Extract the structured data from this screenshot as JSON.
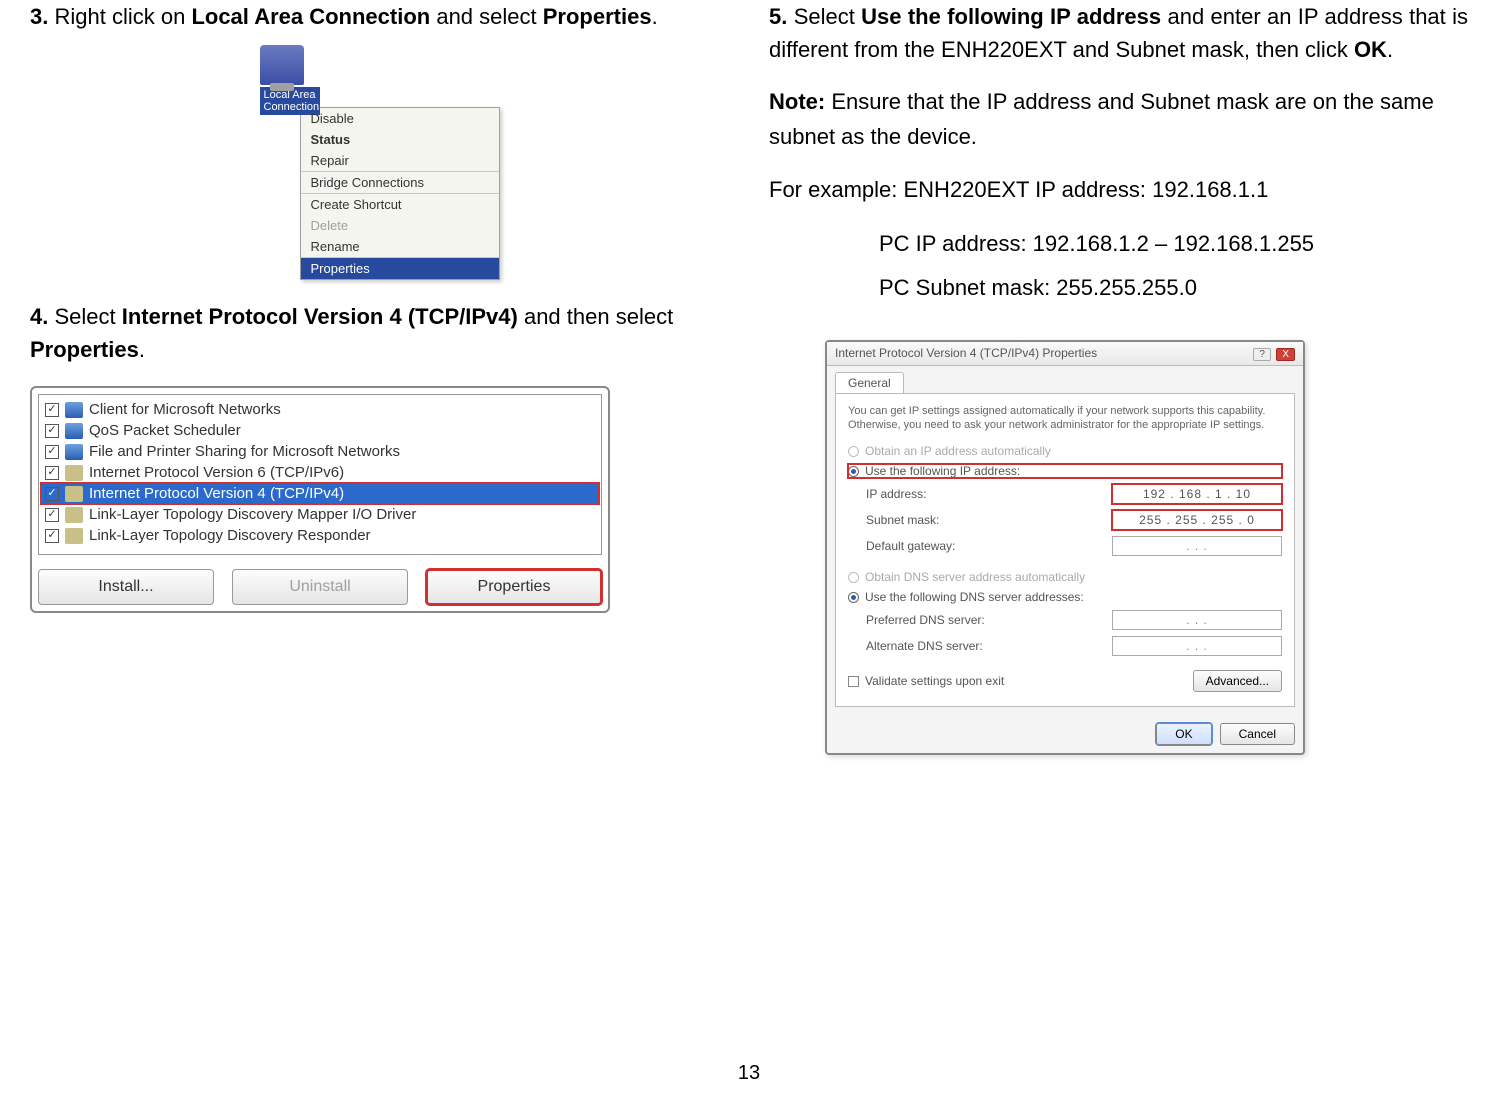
{
  "left": {
    "step3": {
      "num": "3.",
      "pre": "Right click on ",
      "b1": "Local Area Connection",
      "mid": " and select ",
      "b2": "Properties",
      "post": "."
    },
    "lac_label_line1": "Local Area",
    "lac_label_line2": "Connection",
    "ctx": {
      "disable": "Disable",
      "status": "Status",
      "repair": "Repair",
      "bridge": "Bridge Connections",
      "shortcut": "Create Shortcut",
      "delete": "Delete",
      "rename": "Rename",
      "properties": "Properties"
    },
    "step4": {
      "num": "4.",
      "pre": "Select ",
      "b1": "Internet Protocol Version 4 (TCP/IPv4)",
      "mid": " and then select ",
      "b2": "Properties",
      "post": "."
    },
    "connitems": [
      "Client for Microsoft Networks",
      "QoS Packet Scheduler",
      "File and Printer Sharing for Microsoft Networks",
      "Internet Protocol Version 6 (TCP/IPv6)",
      "Internet Protocol Version 4 (TCP/IPv4)",
      "Link-Layer Topology Discovery Mapper I/O Driver",
      "Link-Layer Topology Discovery Responder"
    ],
    "buttons": {
      "install": "Install...",
      "uninstall": "Uninstall",
      "properties": "Properties"
    }
  },
  "right": {
    "step5": {
      "num": "5.",
      "pre": "Select ",
      "b1": "Use the following IP address",
      "mid": " and enter an IP address that is different from the ENH220EXT and Subnet mask, then click ",
      "b2": "OK",
      "post": "."
    },
    "note_label": "Note:",
    "note_text": " Ensure that the IP address and Subnet mask are on the same subnet as the device.",
    "example_label": "For example: ENH220EXT IP address: 192.168.1.1",
    "pcip": "PC IP address: 192.168.1.2 – 192.168.1.255",
    "pcmask": "PC Subnet mask: 255.255.255.0",
    "dlg": {
      "title": "Internet Protocol Version 4 (TCP/IPv4) Properties",
      "help": "?",
      "close": "X",
      "tab": "General",
      "desc": "You can get IP settings assigned automatically if your network supports this capability. Otherwise, you need to ask your network administrator for the appropriate IP settings.",
      "r_auto_ip": "Obtain an IP address automatically",
      "r_use_ip": "Use the following IP address:",
      "lbl_ip": "IP address:",
      "val_ip": "192 . 168 .  1  .  10",
      "lbl_mask": "Subnet mask:",
      "val_mask": "255 . 255 . 255 .  0",
      "lbl_gw": "Default gateway:",
      "val_gw": ".       .       .",
      "r_auto_dns": "Obtain DNS server address automatically",
      "r_use_dns": "Use the following DNS server addresses:",
      "lbl_pdns": "Preferred DNS server:",
      "lbl_adns": "Alternate DNS server:",
      "val_dns": ".       .       .",
      "validate": "Validate settings upon exit",
      "advanced": "Advanced...",
      "ok": "OK",
      "cancel": "Cancel"
    }
  },
  "page_number": "13"
}
